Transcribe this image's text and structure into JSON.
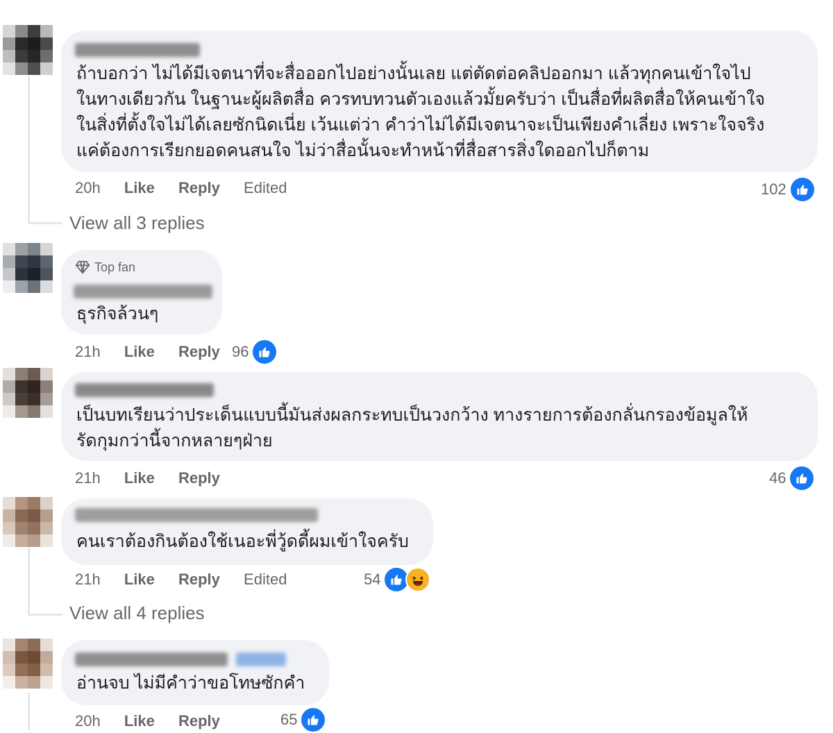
{
  "comments": [
    {
      "text_lines": [
        "ถ้าบอกว่า ไม่ได้มีเจตนาที่จะสื่อออกไปอย่างนั้นเลย แต่ตัดต่อคลิปออกมา แล้วทุกคนเข้าใจไป",
        "ในทางเดียวกัน ในฐานะผู้ผลิตสื่อ ควรทบทวนตัวเองแล้วมั้ยครับว่า เป็นสื่อที่ผลิตสื่อให้คนเข้าใจ",
        "ในสิ่งที่ตั้งใจไม่ได้เลยซักนิดเนี่ย เว้นแต่ว่า คำว่าไม่ได้มีเจตนาจะเป็นเพียงคำเลี่ยง เพราะใจจริง",
        "แค่ต้องการเรียกยอดคนสนใจ ไม่ว่าสื่อนั้นจะทำหน้าที่สื่อสารสิ่งใดออกไปก็ตาม"
      ],
      "time": "20h",
      "like": "Like",
      "reply": "Reply",
      "edited": "Edited",
      "reactions": "102",
      "view_replies": "View all 3 replies"
    },
    {
      "badge": "Top fan",
      "text_lines": [
        "ธุรกิจล้วนๆ"
      ],
      "time": "21h",
      "like": "Like",
      "reply": "Reply",
      "reactions": "96"
    },
    {
      "text_lines": [
        "เป็นบทเรียนว่าประเด็นแบบนี้มันส่งผลกระทบเป็นวงกว้าง ทางรายการต้องกลั่นกรองข้อมูลให้",
        "รัดกุมกว่านี้จากหลายๆฝ่าย"
      ],
      "time": "21h",
      "like": "Like",
      "reply": "Reply",
      "reactions": "46"
    },
    {
      "text_lines": [
        "คนเราต้องกินต้องใช้เนอะพี่วู้ดดี้ผมเข้าใจครับ"
      ],
      "time": "21h",
      "like": "Like",
      "reply": "Reply",
      "edited": "Edited",
      "reactions": "54",
      "view_replies": "View all 4 replies"
    },
    {
      "text_lines": [
        "อ่านจบ ไม่มีคำว่าขอโทษซักคำ"
      ],
      "time": "20h",
      "like": "Like",
      "reply": "Reply",
      "reactions": "65"
    }
  ],
  "colors": {
    "bubble": "#f0f2f5",
    "meta": "#65676b",
    "like": "#1877f2",
    "haha": "#f7b125"
  },
  "icons": [
    "like-icon",
    "haha-icon",
    "diamond-icon"
  ]
}
